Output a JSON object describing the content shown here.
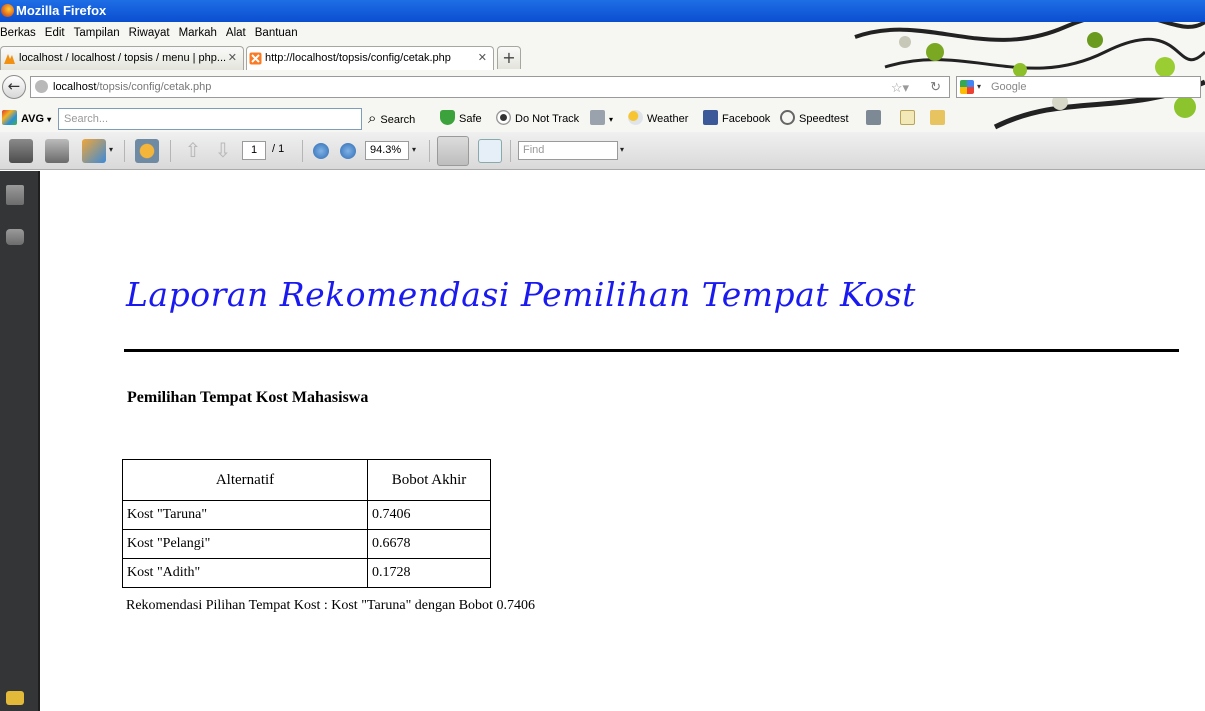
{
  "window": {
    "title": "Mozilla Firefox"
  },
  "menu": [
    "Berkas",
    "Edit",
    "Tampilan",
    "Riwayat",
    "Markah",
    "Alat",
    "Bantuan"
  ],
  "tabs": [
    {
      "label": "localhost / localhost / topsis / menu | php...",
      "icon": "phpmyadmin-icon",
      "active": false
    },
    {
      "label": "http://localhost/topsis/config/cetak.php",
      "icon": "xampp-icon",
      "active": true
    }
  ],
  "navbar": {
    "url_host": "localhost",
    "url_path": "/topsis/config/cetak.php",
    "search_engine_placeholder": "Google"
  },
  "avg_toolbar": {
    "brand": "AVG",
    "search_placeholder": "Search...",
    "search_label": "Search",
    "safe_label": "Safe",
    "dnt_label": "Do Not Track",
    "weather_label": "Weather",
    "facebook_label": "Facebook",
    "speedtest_label": "Speedtest"
  },
  "pdf_toolbar": {
    "page_current": "1",
    "page_total": "/ 1",
    "zoom": "94.3%",
    "find_placeholder": "Find"
  },
  "document": {
    "title": "Laporan Rekomendasi Pemilihan Tempat Kost",
    "subtitle": "Pemilihan Tempat Kost Mahasiswa",
    "table": {
      "headers": [
        "Alternatif",
        "Bobot Akhir"
      ],
      "rows": [
        [
          "Kost \"Taruna\"",
          "0.7406"
        ],
        [
          "Kost \"Pelangi\"",
          "0.6678"
        ],
        [
          "Kost \"Adith\"",
          "0.1728"
        ]
      ]
    },
    "note": "Rekomendasi Pilihan Tempat Kost : Kost \"Taruna\" dengan Bobot 0.7406"
  }
}
